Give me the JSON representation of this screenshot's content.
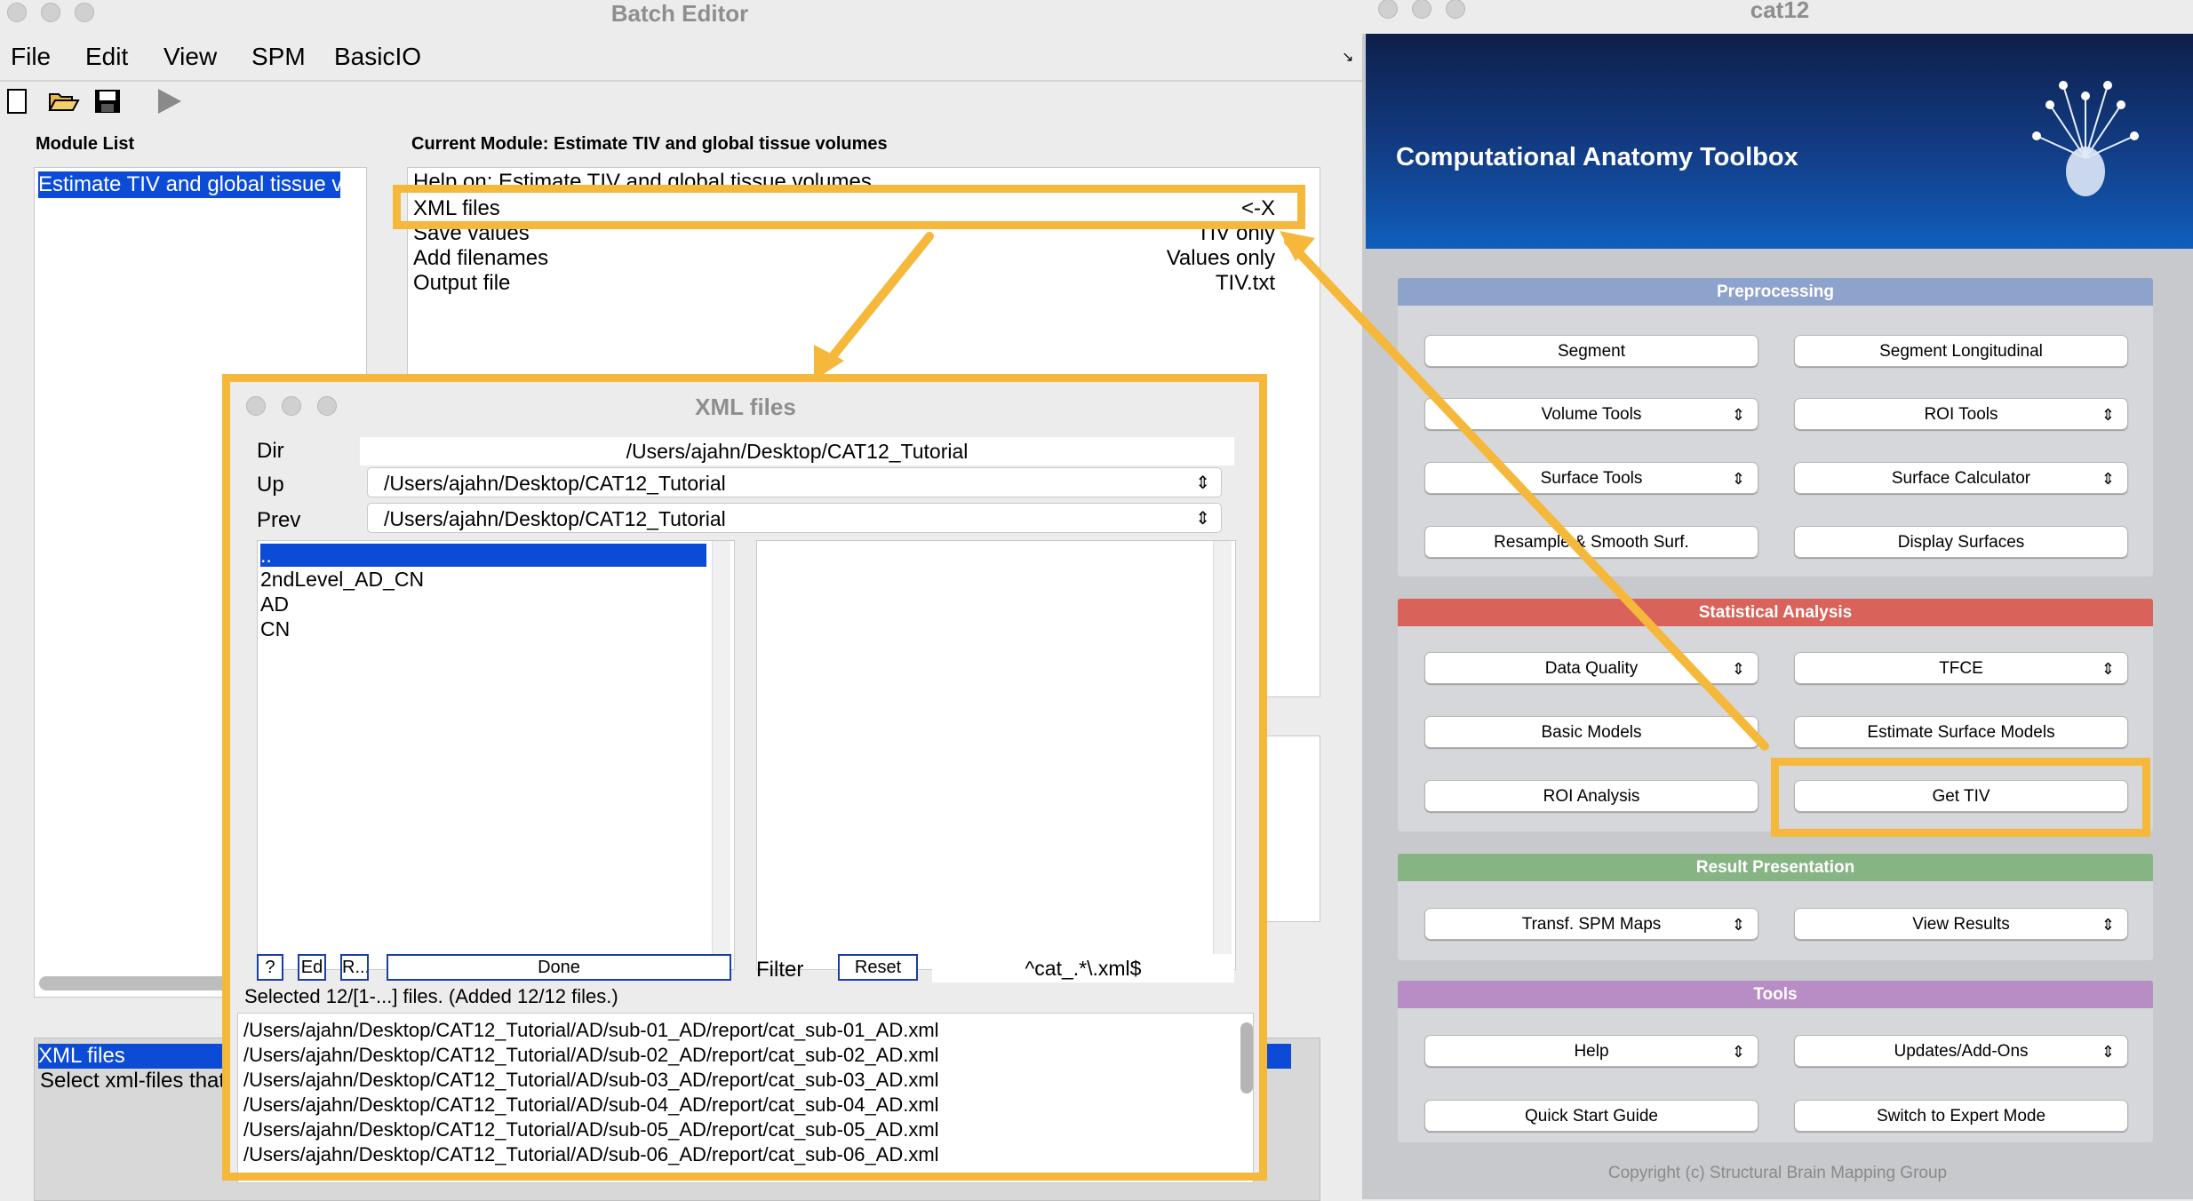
{
  "batch": {
    "title": "Batch Editor",
    "menu": [
      "File",
      "Edit",
      "View",
      "SPM",
      "BasicIO"
    ],
    "module_list_label": "Module List",
    "module_item": "Estimate TIV and global tissue v",
    "current_module_label": "Current Module: Estimate TIV and global tissue volumes",
    "help_line": "Help on: Estimate TIV and global tissue volumes",
    "rows": [
      {
        "name": "XML files",
        "value": "<-X"
      },
      {
        "name": "Save values",
        "value": "TIV only"
      },
      {
        "name": "Add filenames",
        "value": "Values only"
      },
      {
        "name": "Output file",
        "value": "TIV.txt"
      }
    ],
    "bottom_selected": "XML files",
    "bottom_help": "Select xml-files that"
  },
  "xml": {
    "title": "XML files",
    "dir_label": "Dir",
    "dir_value": "/Users/ajahn/Desktop/CAT12_Tutorial",
    "up_label": "Up",
    "up_value": "/Users/ajahn/Desktop/CAT12_Tutorial",
    "prev_label": "Prev",
    "prev_value": "/Users/ajahn/Desktop/CAT12_Tutorial",
    "dirs": [
      "..",
      "2ndLevel_AD_CN",
      "AD",
      "CN"
    ],
    "btn_help": "?",
    "btn_ed": "Ed",
    "btn_r": "R...",
    "btn_done": "Done",
    "filter_label": "Filter",
    "btn_reset": "Reset",
    "filter_value": "^cat_.*\\.xml$",
    "status": "Selected 12/[1-...] files. (Added 12/12 files.)",
    "files": [
      "/Users/ajahn/Desktop/CAT12_Tutorial/AD/sub-01_AD/report/cat_sub-01_AD.xml",
      "/Users/ajahn/Desktop/CAT12_Tutorial/AD/sub-02_AD/report/cat_sub-02_AD.xml",
      "/Users/ajahn/Desktop/CAT12_Tutorial/AD/sub-03_AD/report/cat_sub-03_AD.xml",
      "/Users/ajahn/Desktop/CAT12_Tutorial/AD/sub-04_AD/report/cat_sub-04_AD.xml",
      "/Users/ajahn/Desktop/CAT12_Tutorial/AD/sub-05_AD/report/cat_sub-05_AD.xml",
      "/Users/ajahn/Desktop/CAT12_Tutorial/AD/sub-06_AD/report/cat_sub-06_AD.xml"
    ]
  },
  "cat": {
    "title": "cat12",
    "banner": "Computational Anatomy Toolbox",
    "sections": {
      "pre": "Preprocessing",
      "stat": "Statistical Analysis",
      "result": "Result Presentation",
      "tools": "Tools"
    },
    "buttons": {
      "segment": "Segment",
      "segment_long": "Segment Longitudinal",
      "volume_tools": "Volume Tools",
      "roi_tools": "ROI Tools",
      "surface_tools": "Surface Tools",
      "surface_calc": "Surface Calculator",
      "resample": "Resample & Smooth Surf.",
      "display_surf": "Display Surfaces",
      "data_quality": "Data Quality",
      "tfce": "TFCE",
      "basic_models": "Basic Models",
      "est_surf_models": "Estimate Surface Models",
      "roi_analysis": "ROI Analysis",
      "get_tiv": "Get TIV",
      "transf_spm": "Transf. SPM Maps",
      "view_results": "View Results",
      "help": "Help",
      "updates": "Updates/Add-Ons",
      "quick_start": "Quick Start Guide",
      "expert": "Switch to Expert Mode"
    },
    "copyright": "Copyright (c) Structural Brain Mapping Group"
  },
  "colors": {
    "highlight": "#f5b83b",
    "selection": "#0b4bd6",
    "preprocessing": "#8ea3cc",
    "statistical": "#d9625a",
    "result": "#86b483",
    "tools": "#b88cc4"
  }
}
